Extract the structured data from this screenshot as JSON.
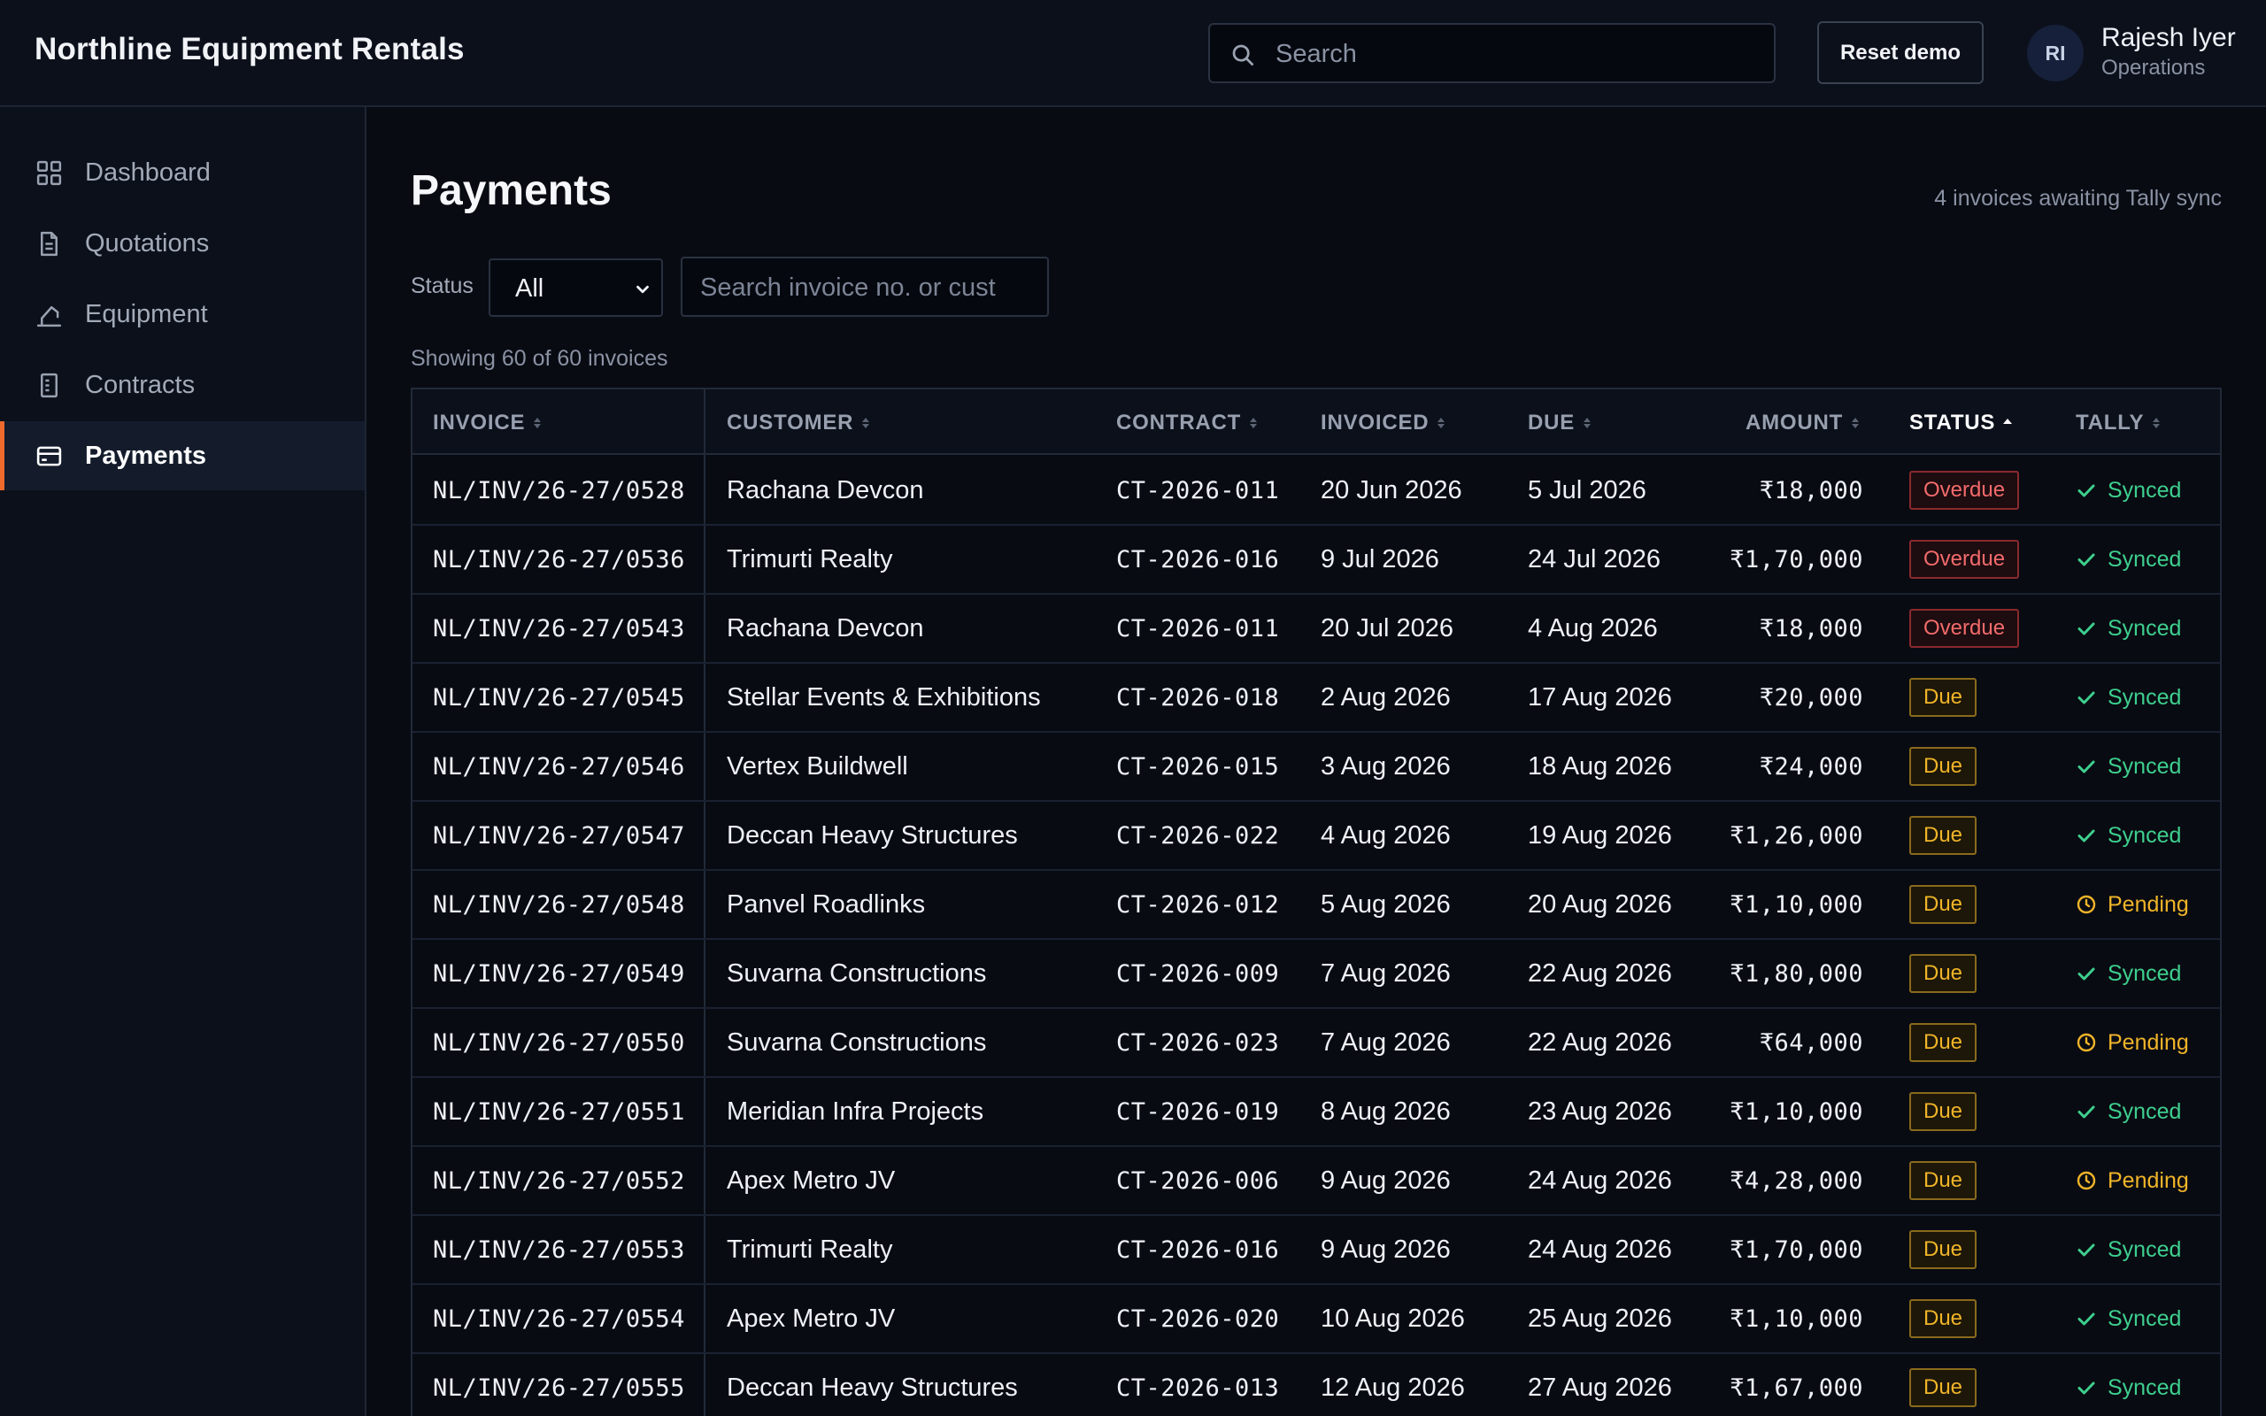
{
  "app": {
    "brand": "Northline Equipment Rentals",
    "search_placeholder": "Search",
    "reset_label": "Reset demo",
    "user": {
      "initials": "RI",
      "name": "Rajesh Iyer",
      "role": "Operations"
    }
  },
  "sidebar": {
    "items": [
      {
        "label": "Dashboard",
        "icon": "grid-icon"
      },
      {
        "label": "Quotations",
        "icon": "document-icon"
      },
      {
        "label": "Equipment",
        "icon": "crane-icon"
      },
      {
        "label": "Contracts",
        "icon": "contract-icon"
      },
      {
        "label": "Payments",
        "icon": "card-icon",
        "active": true
      }
    ]
  },
  "page": {
    "title": "Payments",
    "sync_note": "4 invoices awaiting Tally sync",
    "filter": {
      "status_label": "Status",
      "status_value": "All",
      "search_placeholder": "Search invoice no. or cust"
    },
    "showing": "Showing 60 of 60 invoices"
  },
  "table": {
    "columns": [
      {
        "label": "INVOICE",
        "sort": "none"
      },
      {
        "label": "CUSTOMER",
        "sort": "none"
      },
      {
        "label": "CONTRACT",
        "sort": "none"
      },
      {
        "label": "INVOICED",
        "sort": "none"
      },
      {
        "label": "DUE",
        "sort": "none"
      },
      {
        "label": "AMOUNT",
        "sort": "none"
      },
      {
        "label": "STATUS",
        "sort": "asc"
      },
      {
        "label": "TALLY",
        "sort": "none"
      }
    ],
    "rows": [
      {
        "invoice": "NL/INV/26-27/0528",
        "customer": "Rachana Devcon",
        "contract": "CT-2026-011",
        "invoiced": "20 Jun 2026",
        "due": "5 Jul 2026",
        "amount": "₹18,000",
        "status": "Overdue",
        "tally": "Synced"
      },
      {
        "invoice": "NL/INV/26-27/0536",
        "customer": "Trimurti Realty",
        "contract": "CT-2026-016",
        "invoiced": "9 Jul 2026",
        "due": "24 Jul 2026",
        "amount": "₹1,70,000",
        "status": "Overdue",
        "tally": "Synced"
      },
      {
        "invoice": "NL/INV/26-27/0543",
        "customer": "Rachana Devcon",
        "contract": "CT-2026-011",
        "invoiced": "20 Jul 2026",
        "due": "4 Aug 2026",
        "amount": "₹18,000",
        "status": "Overdue",
        "tally": "Synced"
      },
      {
        "invoice": "NL/INV/26-27/0545",
        "customer": "Stellar Events & Exhibitions",
        "contract": "CT-2026-018",
        "invoiced": "2 Aug 2026",
        "due": "17 Aug 2026",
        "amount": "₹20,000",
        "status": "Due",
        "tally": "Synced"
      },
      {
        "invoice": "NL/INV/26-27/0546",
        "customer": "Vertex Buildwell",
        "contract": "CT-2026-015",
        "invoiced": "3 Aug 2026",
        "due": "18 Aug 2026",
        "amount": "₹24,000",
        "status": "Due",
        "tally": "Synced"
      },
      {
        "invoice": "NL/INV/26-27/0547",
        "customer": "Deccan Heavy Structures",
        "contract": "CT-2026-022",
        "invoiced": "4 Aug 2026",
        "due": "19 Aug 2026",
        "amount": "₹1,26,000",
        "status": "Due",
        "tally": "Synced"
      },
      {
        "invoice": "NL/INV/26-27/0548",
        "customer": "Panvel Roadlinks",
        "contract": "CT-2026-012",
        "invoiced": "5 Aug 2026",
        "due": "20 Aug 2026",
        "amount": "₹1,10,000",
        "status": "Due",
        "tally": "Pending"
      },
      {
        "invoice": "NL/INV/26-27/0549",
        "customer": "Suvarna Constructions",
        "contract": "CT-2026-009",
        "invoiced": "7 Aug 2026",
        "due": "22 Aug 2026",
        "amount": "₹1,80,000",
        "status": "Due",
        "tally": "Synced"
      },
      {
        "invoice": "NL/INV/26-27/0550",
        "customer": "Suvarna Constructions",
        "contract": "CT-2026-023",
        "invoiced": "7 Aug 2026",
        "due": "22 Aug 2026",
        "amount": "₹64,000",
        "status": "Due",
        "tally": "Pending"
      },
      {
        "invoice": "NL/INV/26-27/0551",
        "customer": "Meridian Infra Projects",
        "contract": "CT-2026-019",
        "invoiced": "8 Aug 2026",
        "due": "23 Aug 2026",
        "amount": "₹1,10,000",
        "status": "Due",
        "tally": "Synced"
      },
      {
        "invoice": "NL/INV/26-27/0552",
        "customer": "Apex Metro JV",
        "contract": "CT-2026-006",
        "invoiced": "9 Aug 2026",
        "due": "24 Aug 2026",
        "amount": "₹4,28,000",
        "status": "Due",
        "tally": "Pending"
      },
      {
        "invoice": "NL/INV/26-27/0553",
        "customer": "Trimurti Realty",
        "contract": "CT-2026-016",
        "invoiced": "9 Aug 2026",
        "due": "24 Aug 2026",
        "amount": "₹1,70,000",
        "status": "Due",
        "tally": "Synced"
      },
      {
        "invoice": "NL/INV/26-27/0554",
        "customer": "Apex Metro JV",
        "contract": "CT-2026-020",
        "invoiced": "10 Aug 2026",
        "due": "25 Aug 2026",
        "amount": "₹1,10,000",
        "status": "Due",
        "tally": "Synced"
      },
      {
        "invoice": "NL/INV/26-27/0555",
        "customer": "Deccan Heavy Structures",
        "contract": "CT-2026-013",
        "invoiced": "12 Aug 2026",
        "due": "27 Aug 2026",
        "amount": "₹1,67,000",
        "status": "Due",
        "tally": "Synced"
      }
    ]
  },
  "colors": {
    "accent": "#f06a2c",
    "overdue": "#f26b6b",
    "due": "#f0b429",
    "synced": "#3ecf8e",
    "pending": "#f0b429"
  }
}
